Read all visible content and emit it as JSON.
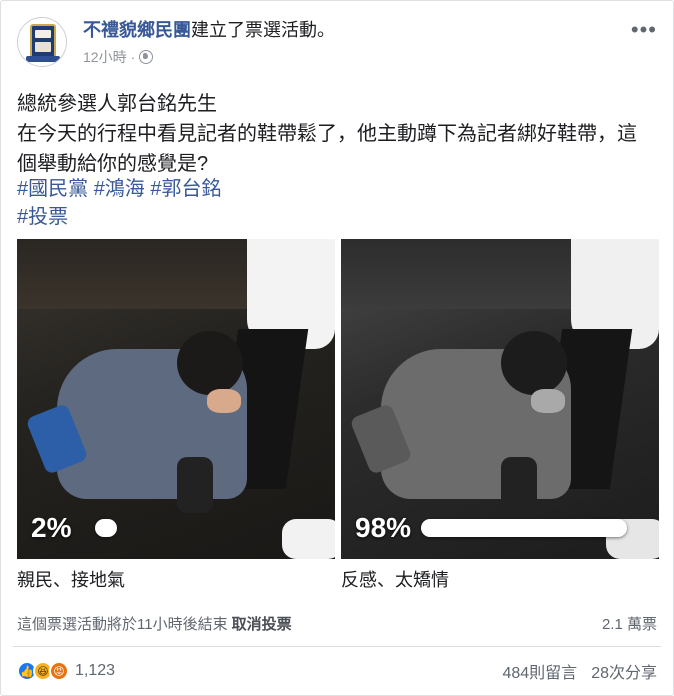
{
  "header": {
    "page_name": "不禮貌鄉民團",
    "action_text": "建立了票選活動。",
    "timestamp": "12小時",
    "separator": "·",
    "privacy_icon": "globe-icon",
    "more_icon": "more-options-icon"
  },
  "post": {
    "lines": [
      "總統參選人郭台銘先生",
      "在今天的行程中看見記者的鞋帶鬆了，他主動蹲下為記者綁好鞋帶，這",
      "個舉動給你的感覺是?"
    ],
    "hashtags_line1": [
      "#國民黨",
      "#鴻海",
      "#郭台銘"
    ],
    "hashtags_line2": [
      "#投票"
    ]
  },
  "poll": {
    "options": [
      {
        "percent_label": "2%",
        "percent": 0.02,
        "text": "親民、接地氣",
        "photo": "color"
      },
      {
        "percent_label": "98%",
        "percent": 0.98,
        "text": "反感、太矯情",
        "photo": "grayscale"
      }
    ],
    "ends_text": "這個票選活動將於11小時後結束",
    "cancel_label": "取消投票",
    "votes_text": "2.1 萬票"
  },
  "footer": {
    "reaction_icons": [
      "like-icon",
      "haha-icon",
      "angry-icon"
    ],
    "reaction_count": "1,123",
    "comments": "484則留言",
    "shares": "28次分享"
  },
  "colors": {
    "link": "#385898",
    "text": "#1c1e21",
    "muted": "#606770",
    "like": "#1877f2",
    "haha": "#f7b125",
    "angry": "#e9710f"
  }
}
